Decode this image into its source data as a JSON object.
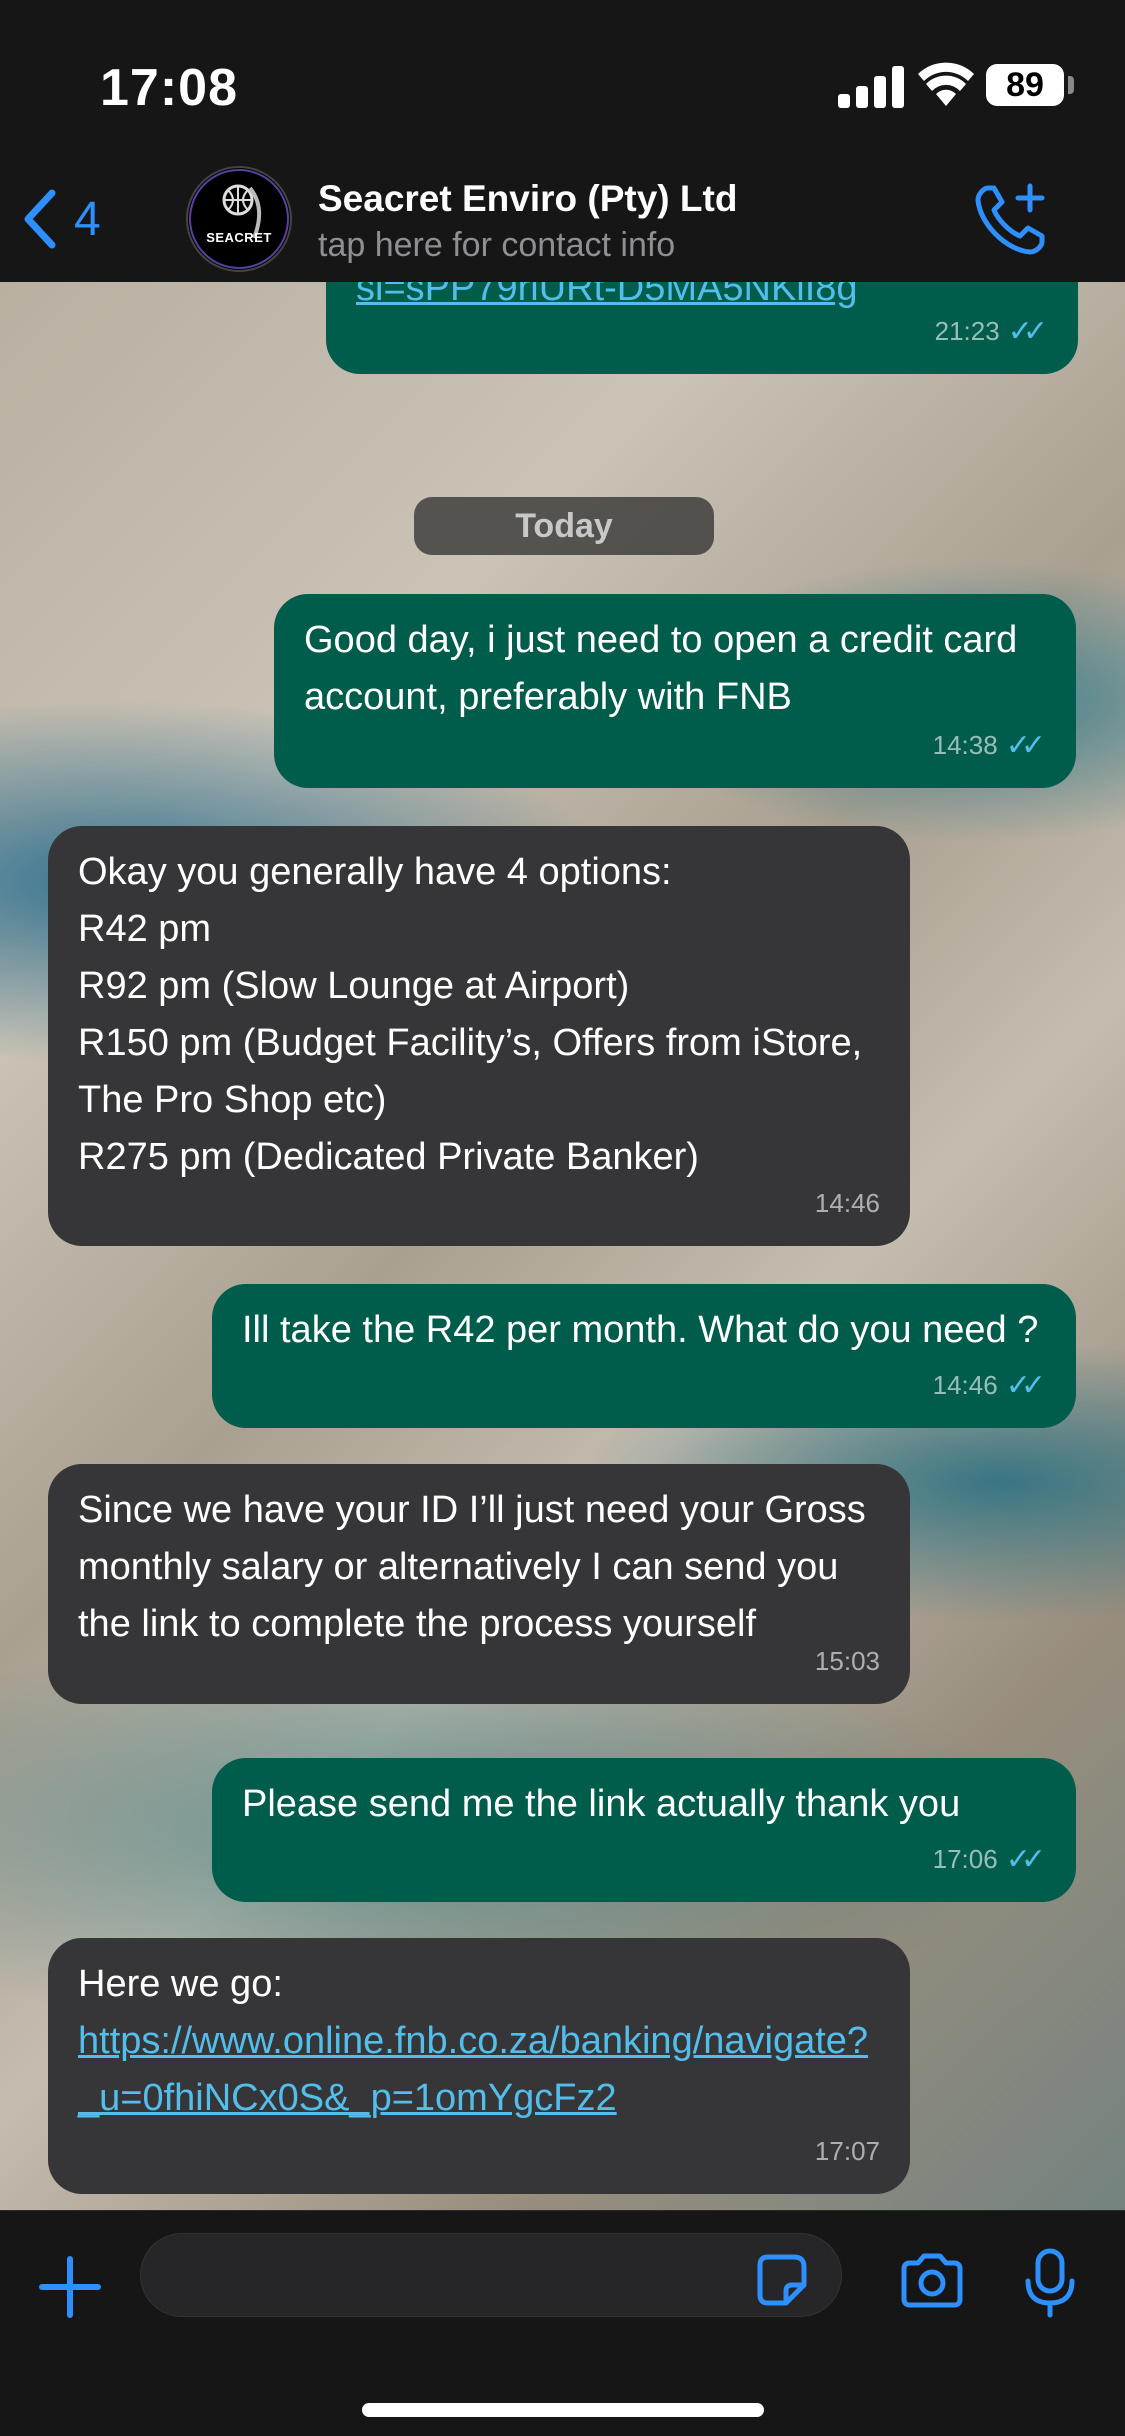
{
  "status": {
    "time": "17:08",
    "battery": "89"
  },
  "header": {
    "back_count": "4",
    "contact_name": "Seacret Enviro (Pty) Ltd",
    "contact_sub": "tap here for contact info",
    "avatar_text": "SEACRET"
  },
  "chat": {
    "date_pill": "Today",
    "messages": [
      {
        "dir": "out",
        "text": "",
        "link": "si=sPP79riURt-D5MA5NKlI8g",
        "time": "21:23"
      },
      {
        "dir": "out",
        "text": "Good day, i just need to open a credit card account, preferably with FNB",
        "time": "14:38"
      },
      {
        "dir": "in",
        "text": "Okay you generally have 4 options:\nR42 pm\nR92 pm (Slow Lounge at Airport)\nR150 pm (Budget Facility’s, Offers from iStore, The Pro Shop etc)\nR275 pm (Dedicated Private Banker)",
        "time": "14:46"
      },
      {
        "dir": "out",
        "text": "Ill take the R42 per month. What do you need ?",
        "time": "14:46"
      },
      {
        "dir": "in",
        "text": "Since we have your ID I’ll just need your Gross monthly salary or alternatively I can send you the link to complete the process yourself",
        "time": "15:03"
      },
      {
        "dir": "out",
        "text": "Please send me the link actually thank you",
        "time": "17:06"
      },
      {
        "dir": "in",
        "text": "Here we go:",
        "link": "https://www.online.fnb.co.za/banking/navigate?_u=0fhiNCx0S&_p=1omYgcFz2",
        "time": "17:07"
      }
    ]
  },
  "colors": {
    "accent": "#2e8fff",
    "outgoing": "#005c4b",
    "incoming": "#363638",
    "read_ticks": "#53bdeb"
  }
}
